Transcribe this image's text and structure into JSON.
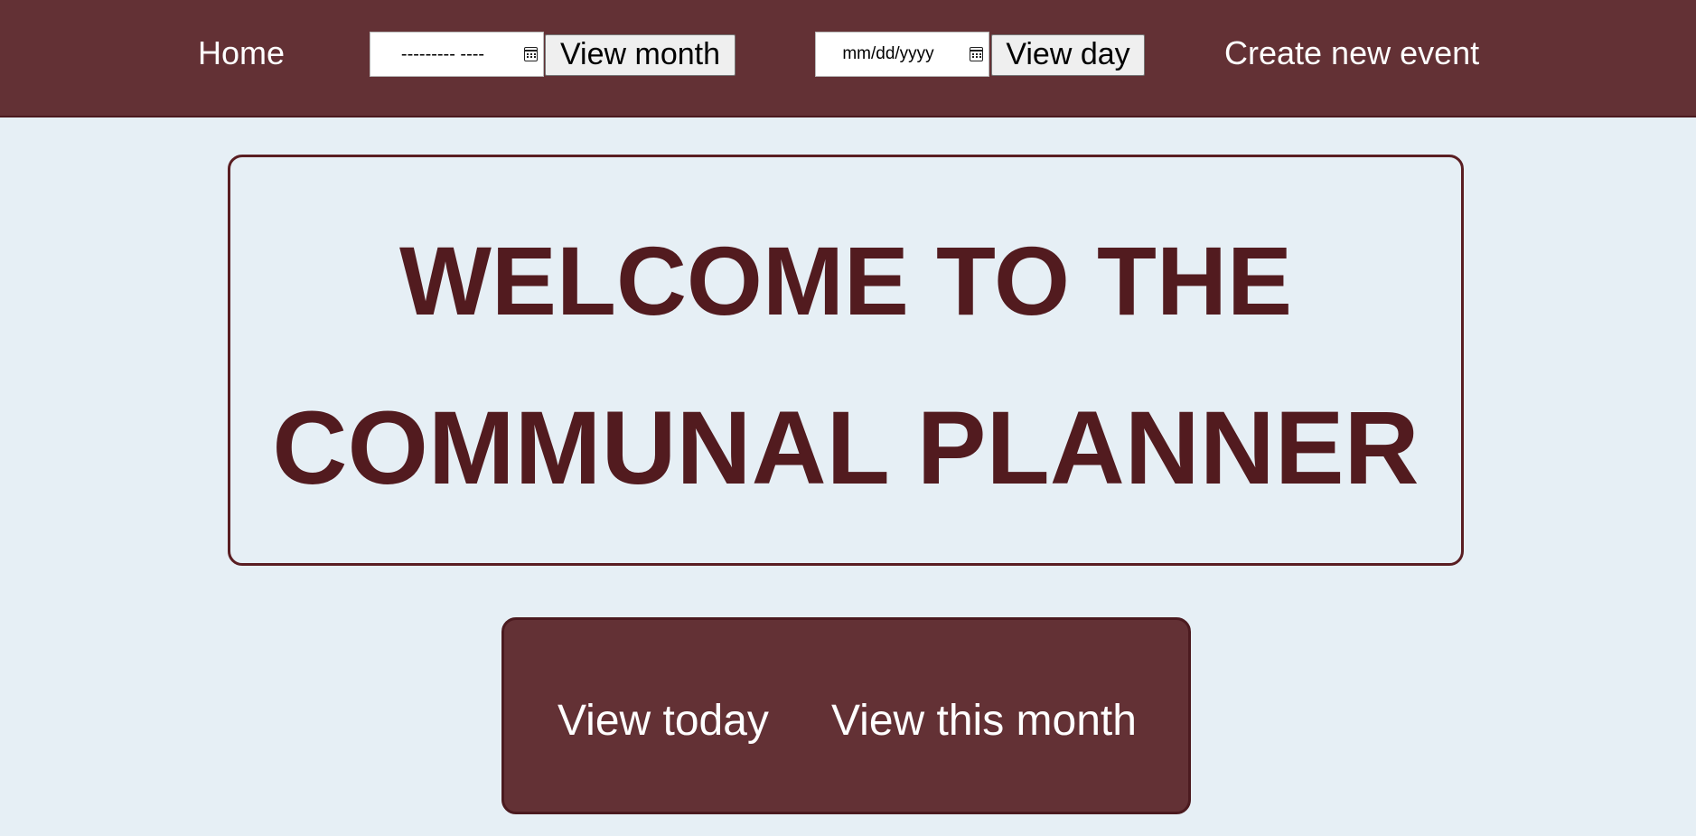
{
  "nav": {
    "home_label": "Home",
    "month_input_value": "--------- ----",
    "view_month_label": "View month",
    "day_input_value": "mm/dd/yyyy",
    "view_day_label": "View day",
    "create_event_label": "Create new event"
  },
  "welcome": {
    "line1": "WELCOME TO THE",
    "line2": "COMMUNAL PLANNER"
  },
  "actions": {
    "view_today_label": "View today",
    "view_this_month_label": "View this month"
  },
  "icons": {
    "month_picker": "calendar-icon",
    "day_picker": "calendar-icon"
  },
  "colors": {
    "header_bg": "#633135",
    "page_bg": "#e6eff5",
    "title_text": "#521b1f",
    "nav_text": "#ffffff"
  }
}
